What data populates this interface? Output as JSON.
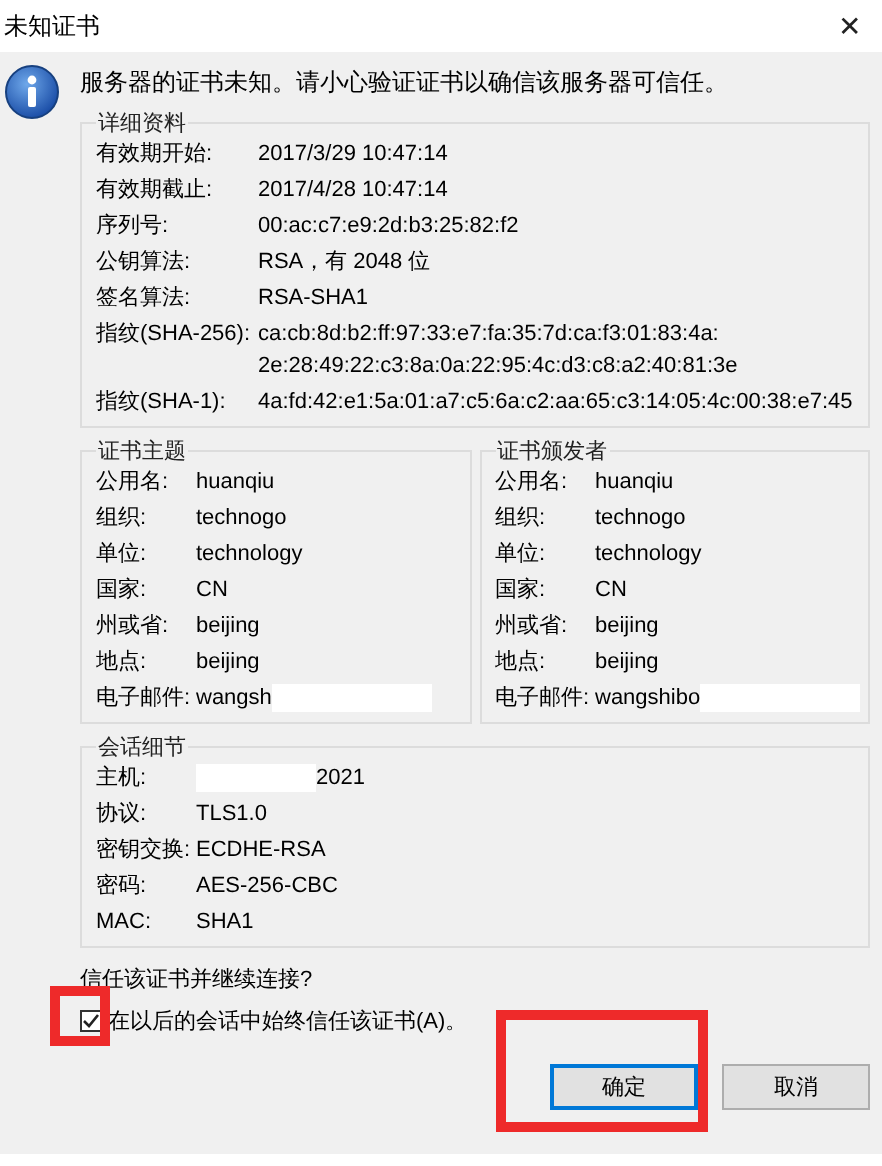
{
  "window": {
    "title": "未知证书",
    "close": "✕"
  },
  "message": "服务器的证书未知。请小心验证证书以确信该服务器可信任。",
  "details": {
    "title": "详细资料",
    "rows": [
      {
        "label": "有效期开始:",
        "value": "2017/3/29 10:47:14"
      },
      {
        "label": "有效期截止:",
        "value": "2017/4/28 10:47:14"
      },
      {
        "label": "序列号:",
        "value": "00:ac:c7:e9:2d:b3:25:82:f2"
      },
      {
        "label": "公钥算法:",
        "value": "RSA，有 2048 位"
      },
      {
        "label": "签名算法:",
        "value": "RSA-SHA1"
      },
      {
        "label": "指纹(SHA-256):",
        "value": "ca:cb:8d:b2:ff:97:33:e7:fa:35:7d:ca:f3:01:83:4a:\n2e:28:49:22:c3:8a:0a:22:95:4c:d3:c8:a2:40:81:3e"
      },
      {
        "label": "指纹(SHA-1):",
        "value": "4a:fd:42:e1:5a:01:a7:c5:6a:c2:aa:65:c3:14:05:4c:00:38:e7:45"
      }
    ]
  },
  "subject": {
    "title": "证书主题",
    "rows": [
      {
        "label": "公用名:",
        "value": "huanqiu"
      },
      {
        "label": "组织:",
        "value": "technogo"
      },
      {
        "label": "单位:",
        "value": "technology"
      },
      {
        "label": "国家:",
        "value": "CN"
      },
      {
        "label": "州或省:",
        "value": "beijing"
      },
      {
        "label": "地点:",
        "value": "beijing"
      },
      {
        "label": "电子邮件:",
        "value": "wangsh",
        "redacted_after": true
      }
    ]
  },
  "issuer": {
    "title": "证书颁发者",
    "rows": [
      {
        "label": "公用名:",
        "value": "huanqiu"
      },
      {
        "label": "组织:",
        "value": "technogo"
      },
      {
        "label": "单位:",
        "value": "technology"
      },
      {
        "label": "国家:",
        "value": "CN"
      },
      {
        "label": "州或省:",
        "value": "beijing"
      },
      {
        "label": "地点:",
        "value": "beijing"
      },
      {
        "label": "电子邮件:",
        "value": "wangshibo",
        "redacted_after": true
      }
    ]
  },
  "session": {
    "title": "会话细节",
    "rows": [
      {
        "label": "主机:",
        "value": "2021",
        "redacted_before": true
      },
      {
        "label": "协议:",
        "value": "TLS1.0"
      },
      {
        "label": "密钥交换:",
        "value": "ECDHE-RSA"
      },
      {
        "label": "密码:",
        "value": "AES-256-CBC"
      },
      {
        "label": "MAC:",
        "value": "SHA1"
      }
    ]
  },
  "question": "信任该证书并继续连接?",
  "always_trust": {
    "label": "在以后的会话中始终信任该证书(A)。",
    "checked": true,
    "highlighted": true
  },
  "buttons": [
    {
      "label": "确定",
      "default": true,
      "highlighted": true
    },
    {
      "label": "取消",
      "default": false,
      "highlighted": false
    }
  ]
}
